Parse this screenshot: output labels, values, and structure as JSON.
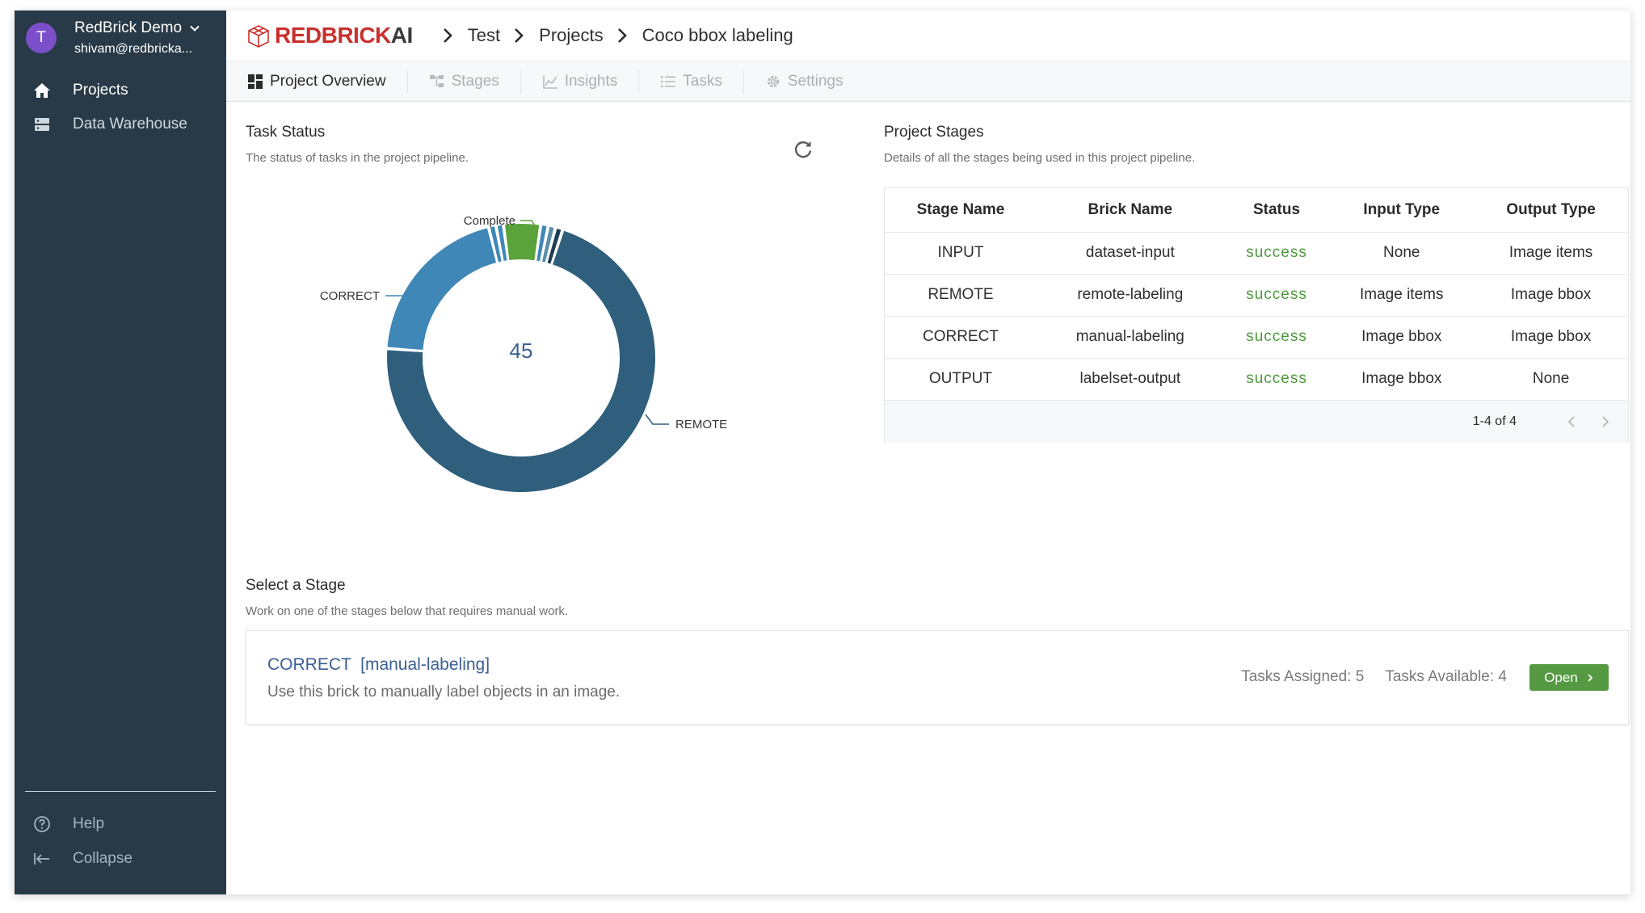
{
  "org": {
    "avatar_letter": "T",
    "name": "RedBrick Demo",
    "email": "shivam@redbricka..."
  },
  "sidebar": {
    "items": [
      {
        "label": "Projects",
        "icon": "home-icon"
      },
      {
        "label": "Data Warehouse",
        "icon": "server-icon"
      }
    ],
    "bottom": [
      {
        "label": "Help",
        "icon": "help-icon"
      },
      {
        "label": "Collapse",
        "icon": "collapse-icon"
      }
    ]
  },
  "header": {
    "logo_red": "REDBRICK",
    "logo_dark": "AI",
    "breadcrumbs": [
      "Test",
      "Projects",
      "Coco bbox labeling"
    ]
  },
  "tabs": [
    {
      "label": "Project Overview",
      "icon": "dashboard-icon"
    },
    {
      "label": "Stages",
      "icon": "stages-icon"
    },
    {
      "label": "Insights",
      "icon": "chart-icon"
    },
    {
      "label": "Tasks",
      "icon": "list-icon"
    },
    {
      "label": "Settings",
      "icon": "gear-icon"
    }
  ],
  "task_status": {
    "title": "Task Status",
    "subtitle": "The status of tasks in the project pipeline."
  },
  "chart_data": {
    "type": "pie",
    "center_label": "45",
    "slices": [
      {
        "name": "REMOTE",
        "value": 32,
        "color": "#2f5f7c"
      },
      {
        "name": "CORRECT",
        "value": 9,
        "color": "#3f87b6"
      },
      {
        "name": "",
        "value": 0.4,
        "color": "#3f87b6"
      },
      {
        "name": "",
        "value": 0.4,
        "color": "#3f87b6"
      },
      {
        "name": "Complete",
        "value": 2,
        "color": "#5aa23a"
      },
      {
        "name": "",
        "value": 0.4,
        "color": "#3f87b6"
      },
      {
        "name": "",
        "value": 0.4,
        "color": "#5b8fa8"
      },
      {
        "name": "",
        "value": 0.4,
        "color": "#1f3d52"
      }
    ],
    "labels": [
      {
        "text": "Complete"
      },
      {
        "text": "CORRECT"
      },
      {
        "text": "REMOTE"
      }
    ]
  },
  "project_stages": {
    "title": "Project Stages",
    "subtitle": "Details of all the stages being used in this project pipeline.",
    "columns": [
      "Stage Name",
      "Brick Name",
      "Status",
      "Input Type",
      "Output Type"
    ],
    "rows": [
      [
        "INPUT",
        "dataset-input",
        "success",
        "None",
        "Image items"
      ],
      [
        "REMOTE",
        "remote-labeling",
        "success",
        "Image items",
        "Image bbox"
      ],
      [
        "CORRECT",
        "manual-labeling",
        "success",
        "Image bbox",
        "Image bbox"
      ],
      [
        "OUTPUT",
        "labelset-output",
        "success",
        "Image bbox",
        "None"
      ]
    ],
    "pager_range": "1-4 of 4"
  },
  "select_stage": {
    "title": "Select a Stage",
    "subtitle": "Work on one of the stages below that requires manual work.",
    "card": {
      "name": "CORRECT  [manual-labeling]",
      "description": "Use this brick to manually label objects in an image.",
      "assigned": "Tasks Assigned: 5",
      "available": "Tasks Available: 4",
      "open_label": "Open"
    }
  },
  "colors": {
    "sidebar": "#283a47",
    "success": "#4d9a3c",
    "open_button": "#559a43",
    "link": "#3b5f94"
  }
}
